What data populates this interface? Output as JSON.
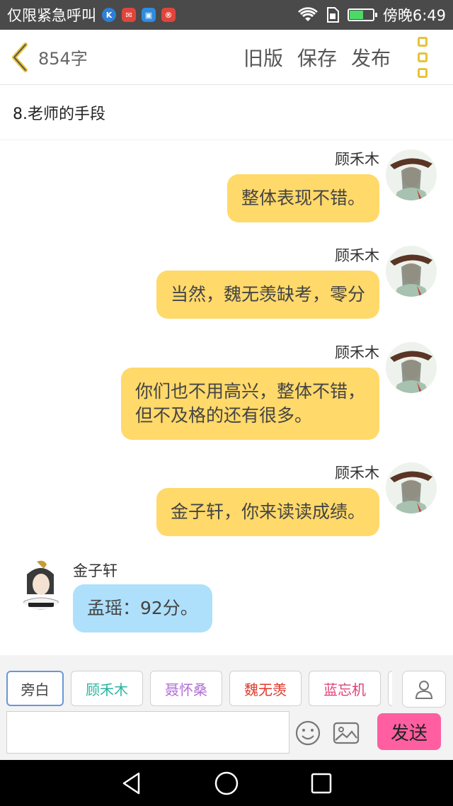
{
  "status": {
    "left_text": "仅限紧急呼叫",
    "right_text": "傍晚6:49",
    "battery_level": 0.6
  },
  "header": {
    "word_count": "854字",
    "actions": [
      "旧版",
      "保存",
      "发布"
    ]
  },
  "chapter_title": "8.老师的手段",
  "messages": [
    {
      "side": "right",
      "speaker": "顾禾木",
      "lines": [
        "整体表现不错。"
      ]
    },
    {
      "side": "right",
      "speaker": "顾禾木",
      "lines": [
        "当然，魏无羡缺考，零分"
      ]
    },
    {
      "side": "right",
      "speaker": "顾禾木",
      "lines": [
        "你们也不用高兴，整体不错，",
        "但不及格的还有很多。"
      ]
    },
    {
      "side": "right",
      "speaker": "顾禾木",
      "lines": [
        "金子轩，你来读读成绩。"
      ]
    },
    {
      "side": "left",
      "speaker": "金子轩",
      "lines": [
        "孟瑶：92分。"
      ]
    }
  ],
  "characters": [
    {
      "label": "旁白",
      "color": "#444444"
    },
    {
      "label": "顾禾木",
      "color": "#2bb5a0"
    },
    {
      "label": "聂怀桑",
      "color": "#b06fd6"
    },
    {
      "label": "魏无羡",
      "color": "#e03a2b"
    },
    {
      "label": "蓝忘机",
      "color": "#e0407a"
    }
  ],
  "input": {
    "placeholder": "",
    "value": ""
  },
  "send_label": "发送",
  "colors": {
    "right_bubble": "#ffd96a",
    "left_bubble": "#aee0fb",
    "send": "#ff5fa1",
    "accent": "#e6c33b"
  }
}
